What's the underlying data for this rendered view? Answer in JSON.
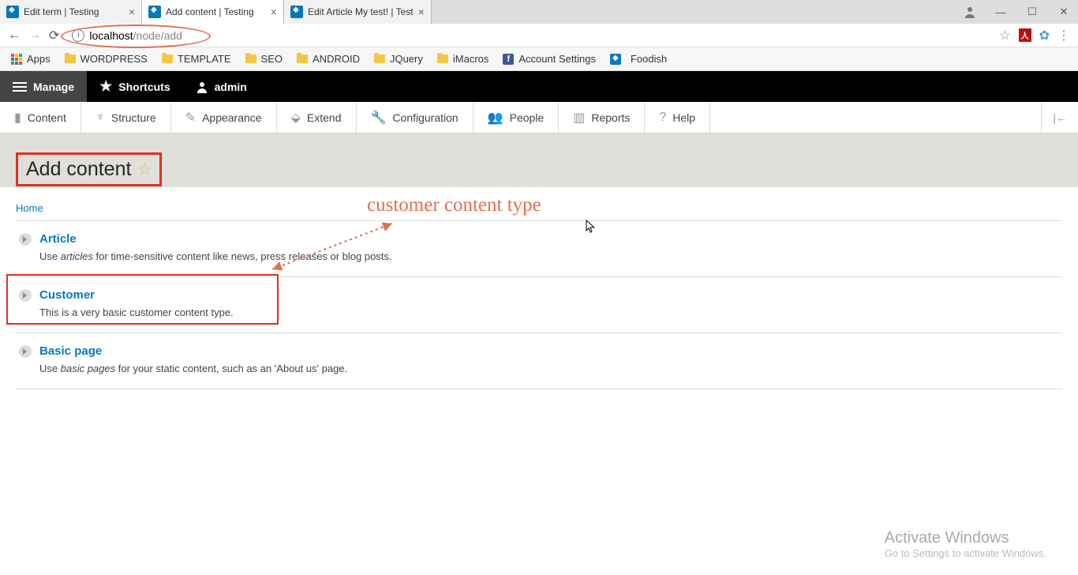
{
  "browser": {
    "tabs": [
      {
        "title": "Edit term | Testing"
      },
      {
        "title": "Add content | Testing"
      },
      {
        "title": "Edit Article My test! | Test"
      }
    ],
    "url_host": "localhost",
    "url_path": "/node/add"
  },
  "bookmarks": [
    "Apps",
    "WORDPRESS",
    "TEMPLATE",
    "SEO",
    "ANDROID",
    "JQuery",
    "iMacros",
    "Account Settings",
    "Foodish"
  ],
  "admin_bar": {
    "manage": "Manage",
    "shortcuts": "Shortcuts",
    "user": "admin"
  },
  "toolbar": [
    "Content",
    "Structure",
    "Appearance",
    "Extend",
    "Configuration",
    "People",
    "Reports",
    "Help"
  ],
  "page": {
    "title": "Add content",
    "breadcrumb": "Home"
  },
  "content_types": [
    {
      "name": "Article",
      "desc_pre": "Use ",
      "desc_em": "articles",
      "desc_post": " for time-sensitive content like news, press releases or blog posts."
    },
    {
      "name": "Customer",
      "desc_pre": "This is a very basic customer content type.",
      "desc_em": "",
      "desc_post": ""
    },
    {
      "name": "Basic page",
      "desc_pre": "Use ",
      "desc_em": "basic pages",
      "desc_post": " for your static content, such as an 'About us' page."
    }
  ],
  "annotation": "customer content type",
  "watermark": {
    "title": "Activate Windows",
    "sub": "Go to Settings to activate Windows."
  }
}
